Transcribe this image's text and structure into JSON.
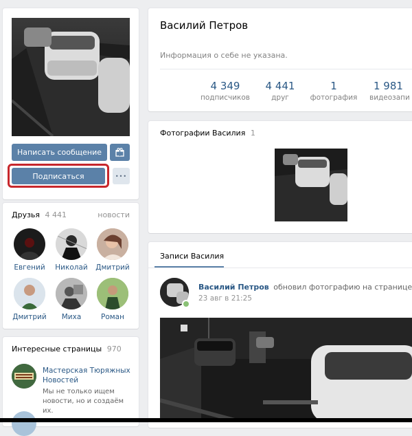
{
  "profile": {
    "name": "Василий Петров",
    "about": "Информация о себе не указана.",
    "write_message": "Написать сообщение",
    "subscribe": "Подписаться",
    "more": "•••"
  },
  "stats": [
    {
      "value": "4 349",
      "label": "подписчиков"
    },
    {
      "value": "4 441",
      "label": "друг"
    },
    {
      "value": "1",
      "label": "фотография"
    },
    {
      "value": "1 981",
      "label": "видеозапи"
    }
  ],
  "friends": {
    "title": "Друзья",
    "count": "4 441",
    "news_link": "новости",
    "items": [
      {
        "name": "Евгений"
      },
      {
        "name": "Николай"
      },
      {
        "name": "Дмитрий"
      },
      {
        "name": "Дмитрий"
      },
      {
        "name": "Миха"
      },
      {
        "name": "Роман"
      }
    ]
  },
  "pages": {
    "title": "Интересные страницы",
    "count": "970",
    "item_name": "Мастерская Тюряжных Новостей",
    "item_desc": "Мы не только ищем новости, но и создаём их."
  },
  "photos": {
    "title": "Фотографии Василия",
    "count": "1"
  },
  "wall": {
    "tab": "Записи Василия",
    "author": "Василий Петров",
    "action": "обновил фотографию на странице:",
    "date": "23 авг в 21:25"
  },
  "colors": {
    "accent": "#5b81a8",
    "subscribe_outline": "#c7272c",
    "link": "#2a5885",
    "background": "#edeef0"
  }
}
